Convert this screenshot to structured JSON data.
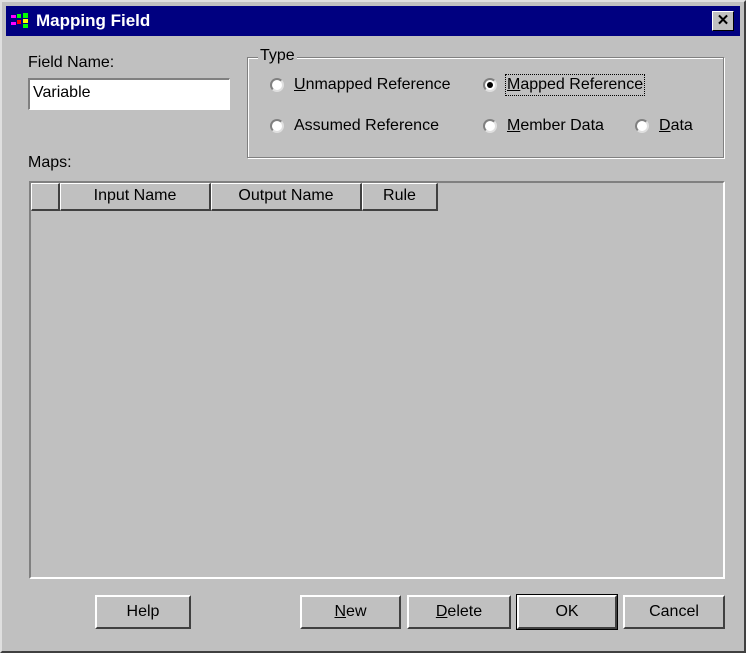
{
  "window": {
    "title": "Mapping Field",
    "close_glyph": "✕"
  },
  "field_name": {
    "label": "Field Name:",
    "value": "Variable"
  },
  "type_group": {
    "title": "Type",
    "options": [
      {
        "label": "Unmapped Reference",
        "selected": false
      },
      {
        "label": "Mapped Reference",
        "selected": true
      },
      {
        "label": "Assumed Reference",
        "selected": false
      },
      {
        "label": "Member Data",
        "selected": false
      },
      {
        "label": "Data",
        "selected": false
      }
    ]
  },
  "maps": {
    "label": "Maps:",
    "columns": [
      "",
      "Input Name",
      "Output Name",
      "Rule"
    ],
    "rows": []
  },
  "buttons": {
    "help": "Help",
    "new": "New",
    "delete": "Delete",
    "ok": "OK",
    "cancel": "Cancel"
  },
  "colors": {
    "titlebar": "#000080",
    "face": "#c0c0c0"
  },
  "icons": {
    "app": "mapping-app-icon",
    "close": "close-icon"
  }
}
